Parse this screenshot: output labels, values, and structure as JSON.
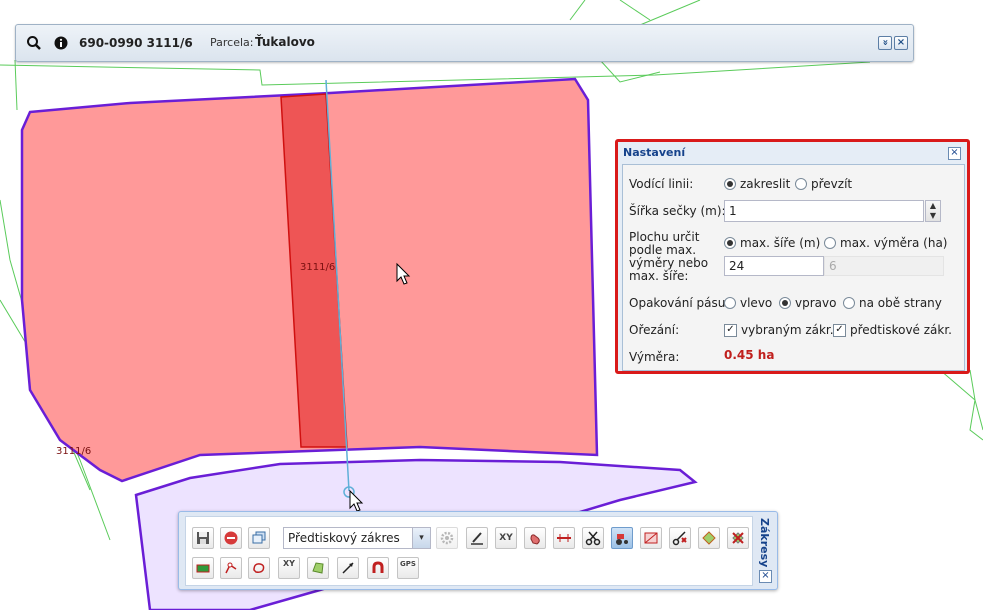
{
  "infobar": {
    "parcel_id": "690-0990 3111/6",
    "parcel_label": "Parcela:",
    "parcel_name": "Ťukalovo",
    "icons": [
      "search-icon",
      "info-icon"
    ],
    "collapse_glyph": "»",
    "close_glyph": "×"
  },
  "map": {
    "label_main": "3111/6",
    "label_lower": "3111/6",
    "colors": {
      "selected_fill": "#ff9999",
      "strip_fill": "#ee5555",
      "outline": "#6a1ed6",
      "lower_fill": "#ede3ff",
      "guide_line": "#5fb0d8",
      "boundary": "#5acb5a"
    }
  },
  "settings": {
    "title": "Nastavení",
    "close_glyph": "×",
    "guide_label": "Vodící linii:",
    "guide_options": [
      "zakreslit",
      "převzít"
    ],
    "guide_selected": "zakreslit",
    "width_label": "Šířka sečky (m):",
    "width_value": "1",
    "area_label_lines": [
      "Plochu určit",
      "podle max.",
      "výměry nebo",
      "max. šíře:"
    ],
    "area_options": [
      "max. šíře (m)",
      "max. výměra (ha)"
    ],
    "area_selected": "max. šíře (m)",
    "max_width_value": "24",
    "max_area_value": "6",
    "repeat_label": "Opakování pásu:",
    "repeat_options": [
      "vlevo",
      "vpravo",
      "na obě strany"
    ],
    "repeat_selected": "vpravo",
    "clip_label": "Ořezání:",
    "clip_options": [
      "vybraným zákr.",
      "předtiskové zákr."
    ],
    "clip_checked": [
      true,
      true
    ],
    "area_result_label": "Výměra:",
    "area_result_value": "0.45 ha",
    "accent_color": "#d91a1a"
  },
  "toolbar": {
    "title": "Zákresy",
    "close_glyph": "×",
    "layer_select_value": "Předtiskový zákres",
    "select_arrow": "▾",
    "row1_buttons": [
      "save-icon",
      "stop-icon",
      "windows-icon",
      "settings-gear-icon",
      "edit-pencil-icon",
      "xy-coordinates-icon",
      "hand-icon",
      "measure-line-icon",
      "cut-scissors-icon",
      "tractor-icon",
      "split-polygon-icon",
      "scissors-cross-icon",
      "merge-icon",
      "delete-polygon-icon"
    ],
    "row2_buttons": [
      "field-strip-icon",
      "node-edit-icon",
      "lasso-icon",
      "xy-line-icon",
      "polygon-icon",
      "arrow-line-icon",
      "magnet-snap-icon",
      "gps-icon"
    ],
    "xy_text": "XY",
    "gps_text": "GPS",
    "active_button": "tractor-icon"
  }
}
